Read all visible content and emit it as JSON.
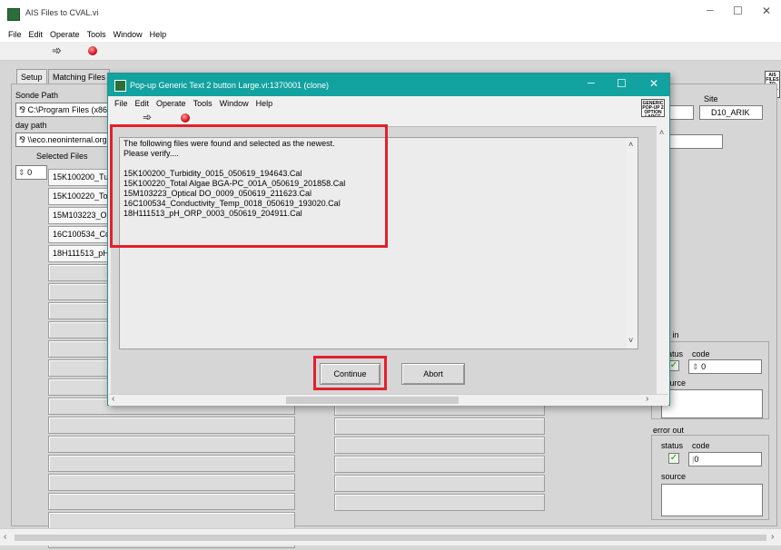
{
  "window": {
    "title": "AIS Files to CVAL.vi",
    "minimize": "─",
    "maximize": "☐",
    "close": "✕",
    "vi_icon_text": "AIS FILES TO CVAL"
  },
  "menu": [
    "File",
    "Edit",
    "Operate",
    "Tools",
    "Window",
    "Help"
  ],
  "tabs": [
    "Setup",
    "Matching Files"
  ],
  "main": {
    "sonde_path_label": "Sonde Path",
    "sonde_path_value": "C:\\Program Files (x86)",
    "day_path_label": "day path",
    "day_path_value": "\\\\eco.neoninternal.org",
    "selected_files_label": "Selected Files",
    "index_value": "0",
    "selected_files": [
      "15K100200_Turbidity",
      "15K100220_Total",
      "15M103223_Optical",
      "16C100534_Cond",
      "18H111513_pH_"
    ],
    "site_label": "Site",
    "site_value": "D10_ARIK"
  },
  "error_in": {
    "label": "error in",
    "status_label": "status",
    "code_label": "code",
    "code_value": "0",
    "source_label": "source",
    "check": "✓"
  },
  "error_out": {
    "label": "error out",
    "status_label": "status",
    "code_label": "code",
    "code_value": "0",
    "source_label": "source",
    "check": "✓"
  },
  "dialog": {
    "title": "Pop-up Generic Text 2 button Large.vi:1370001 (clone)",
    "icon_text": "GENERIC POP-UP 2 OPTION LARGE",
    "message_lines": [
      "The following files were found and selected as the newest.",
      "Please verify....",
      "",
      "15K100200_Turbidity_0015_050619_194643.Cal",
      "15K100220_Total Algae BGA-PC_001A_050619_201858.Cal",
      "15M103223_Optical DO_0009_050619_211623.Cal",
      "16C100534_Conductivity_Temp_0018_050619_193020.Cal",
      "18H111513_pH_ORP_0003_050619_204911.Cal"
    ],
    "continue_label": "Continue",
    "abort_label": "Abort"
  },
  "colors": {
    "dialog_titlebar": "#12a2a0",
    "highlight": "#e3202c",
    "panel": "#d6d6d6"
  }
}
